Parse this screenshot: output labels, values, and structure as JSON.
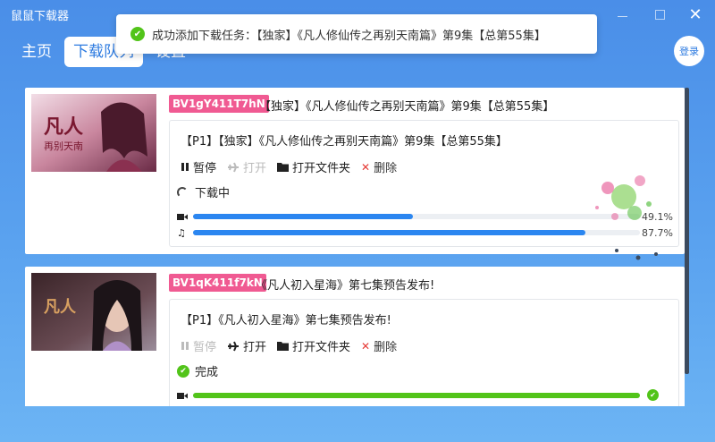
{
  "app": {
    "title": "鼠鼠下载器"
  },
  "window": {
    "minimize": "—",
    "maximize": "□",
    "close": "✕"
  },
  "nav": {
    "tabs": [
      "主页",
      "下载队列",
      "设置"
    ],
    "active_index": 1
  },
  "login": {
    "label": "登录"
  },
  "toast": {
    "message": "成功添加下载任务：【独家】《凡人修仙传之再别天南篇》第9集【总第55集】"
  },
  "downloads": [
    {
      "bvid": "BV1gY411T7hN",
      "title": "【独家】《凡人修仙传之再别天南篇》第9集【总第55集】",
      "part_title": "【P1】【独家】《凡人修仙传之再别天南篇》第9集【总第55集】",
      "actions": {
        "pause": "暂停",
        "open": "打开",
        "open_folder": "打开文件夹",
        "delete": "删除"
      },
      "pause_enabled": true,
      "open_enabled": false,
      "status": "下载中",
      "status_type": "downloading",
      "video_progress": {
        "percent": 49.1,
        "label": "49.1%"
      },
      "audio_progress": {
        "percent": 87.7,
        "label": "87.7%"
      }
    },
    {
      "bvid": "BV1qK411f7kN",
      "title": "《凡人初入星海》第七集预告发布!",
      "part_title": "【P1】《凡人初入星海》第七集预告发布!",
      "actions": {
        "pause": "暂停",
        "open": "打开",
        "open_folder": "打开文件夹",
        "delete": "删除"
      },
      "pause_enabled": false,
      "open_enabled": true,
      "status": "完成",
      "status_type": "done",
      "video_progress": {
        "percent": 100
      }
    }
  ],
  "colors": {
    "accent": "#2b86f0",
    "success": "#52c41a",
    "bvid_badge": "#f05a92",
    "delete": "#e53935"
  }
}
